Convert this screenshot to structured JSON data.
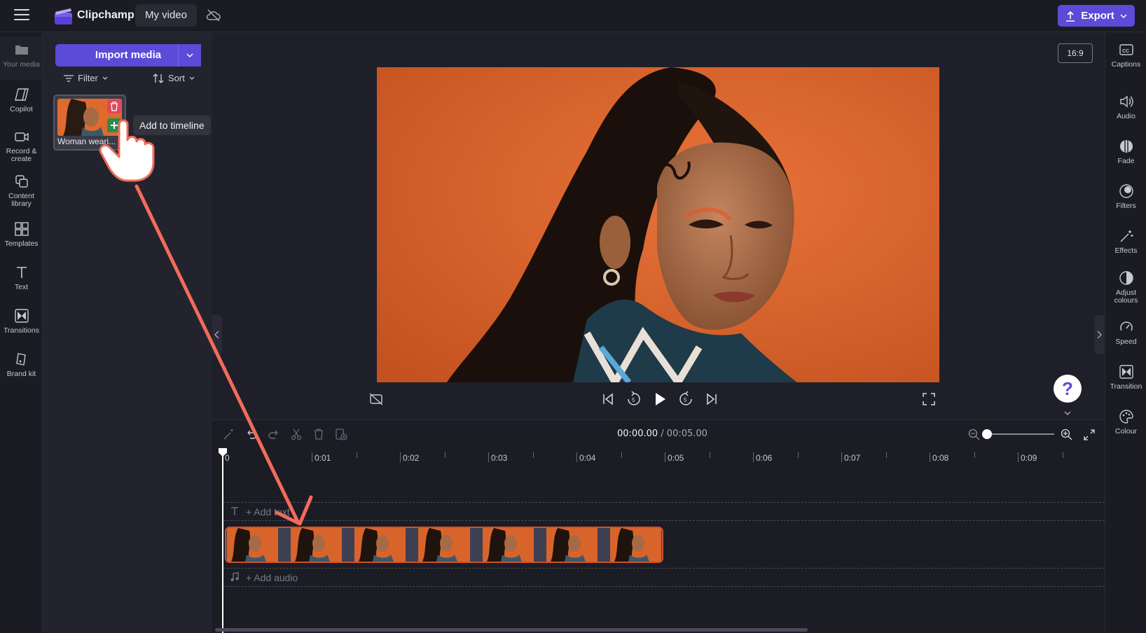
{
  "topbar": {
    "app_title": "Clipchamp",
    "video_name": "My video",
    "export_label": "Export"
  },
  "left_rail": {
    "items": [
      {
        "label": "Your media",
        "icon": "folder-icon"
      },
      {
        "label": "Copilot",
        "icon": "copilot-icon"
      },
      {
        "label": "Record &\ncreate",
        "icon": "camera-icon"
      },
      {
        "label": "Content\nlibrary",
        "icon": "library-icon"
      },
      {
        "label": "Templates",
        "icon": "templates-icon"
      },
      {
        "label": "Text",
        "icon": "text-icon"
      },
      {
        "label": "Transitions",
        "icon": "transitions-icon"
      },
      {
        "label": "Brand kit",
        "icon": "brand-kit-icon"
      }
    ]
  },
  "media_panel": {
    "import_label": "Import media",
    "filter_label": "Filter",
    "sort_label": "Sort",
    "media_item_name": "Woman weari...",
    "tooltip": "Add to timeline"
  },
  "preview": {
    "aspect_ratio": "16:9"
  },
  "right_rail": {
    "items": [
      {
        "label": "Captions",
        "icon": "captions-icon"
      },
      {
        "label": "Audio",
        "icon": "audio-icon"
      },
      {
        "label": "Fade",
        "icon": "fade-icon"
      },
      {
        "label": "Filters",
        "icon": "filters-icon"
      },
      {
        "label": "Effects",
        "icon": "effects-icon"
      },
      {
        "label": "Adjust\ncolours",
        "icon": "adjust-colours-icon"
      },
      {
        "label": "Speed",
        "icon": "speed-icon"
      },
      {
        "label": "Transition",
        "icon": "transition-icon"
      },
      {
        "label": "Colour",
        "icon": "colour-icon"
      }
    ]
  },
  "timeline": {
    "current_time": "00:00.00",
    "separator": " / ",
    "total_time": "00:05.00",
    "ruler_labels": [
      "0",
      "0:01",
      "0:02",
      "0:03",
      "0:04",
      "0:05",
      "0:06",
      "0:07",
      "0:08",
      "0:09"
    ],
    "add_text_label": "+ Add text",
    "add_audio_label": "+ Add audio"
  },
  "colors": {
    "accent": "#5b4bd8",
    "clip_border": "#c8542c",
    "arrow": "#f26b5b"
  },
  "help_label": "?"
}
